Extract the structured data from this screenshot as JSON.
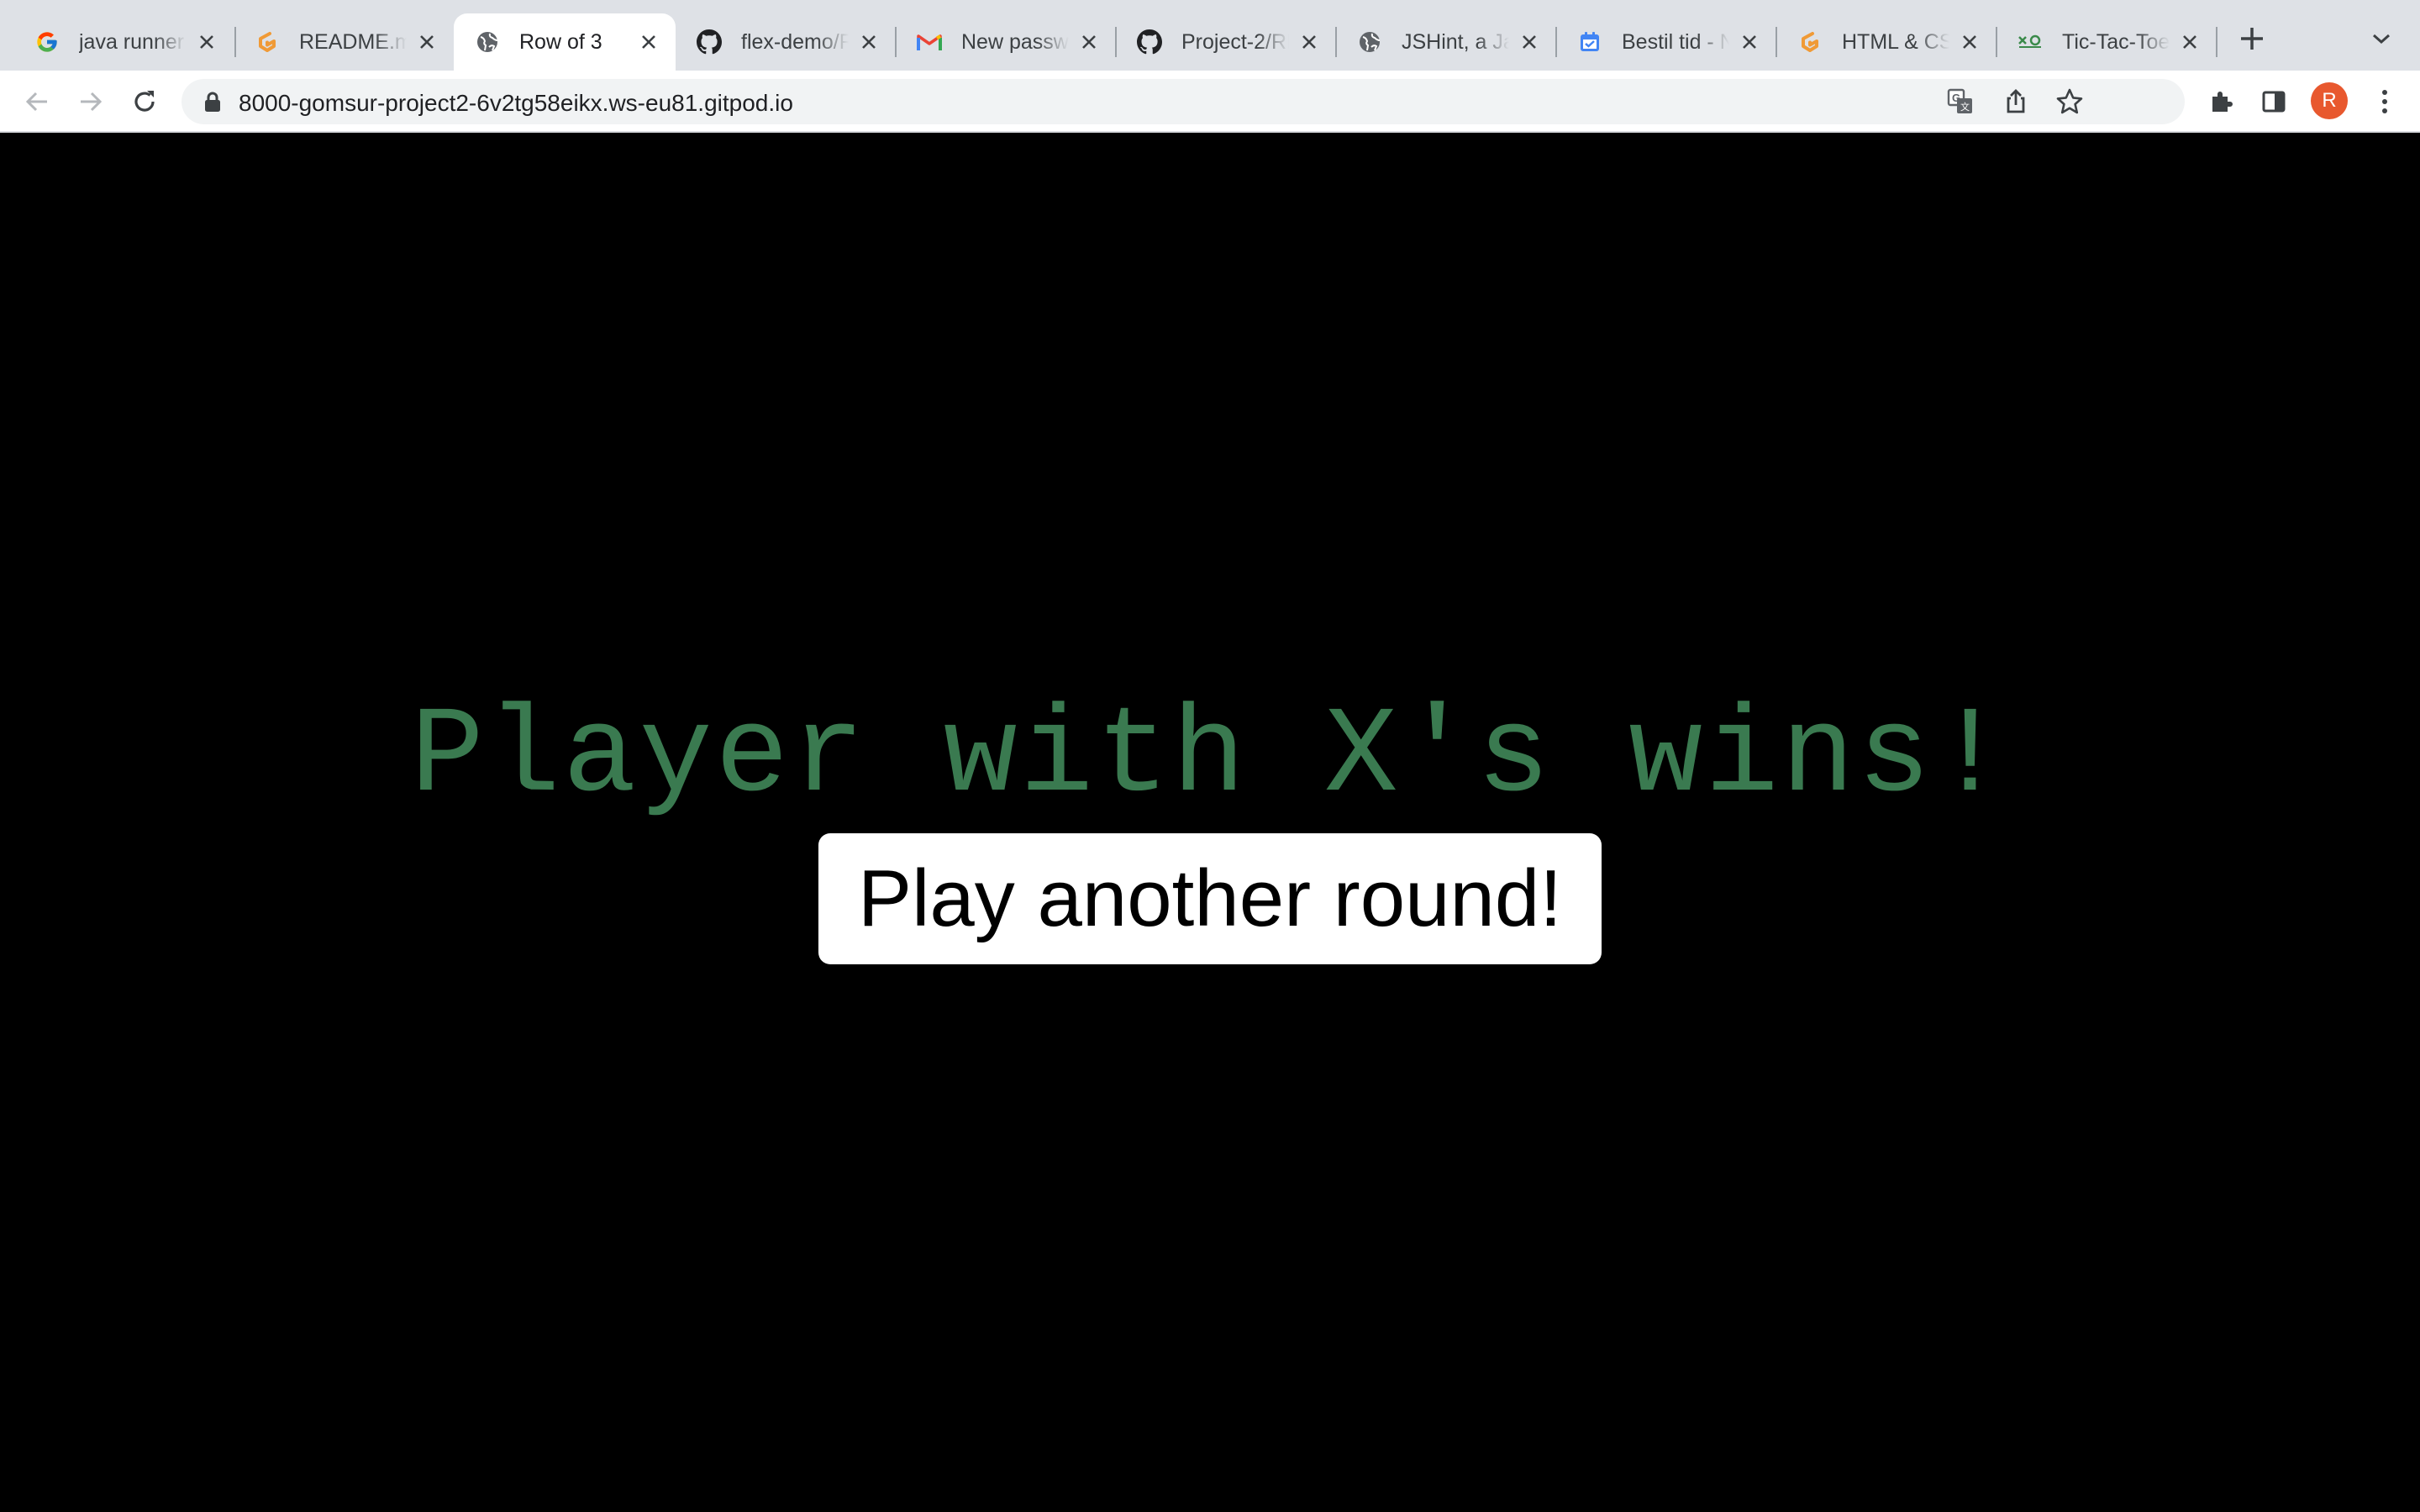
{
  "tabs": [
    {
      "title": "java runner",
      "icon": "google-icon",
      "active": false
    },
    {
      "title": "README.md",
      "icon": "gitpod-icon",
      "active": false
    },
    {
      "title": "Row of 3",
      "icon": "globe-icon",
      "active": true
    },
    {
      "title": "flex-demo/R",
      "icon": "github-icon",
      "active": false
    },
    {
      "title": "New passwo",
      "icon": "gmail-icon",
      "active": false
    },
    {
      "title": "Project-2/RE",
      "icon": "github-icon",
      "active": false
    },
    {
      "title": "JSHint, a Ja",
      "icon": "globe-icon",
      "active": false
    },
    {
      "title": "Bestil tid - N",
      "icon": "calendar-check-icon",
      "active": false
    },
    {
      "title": "HTML & CSS",
      "icon": "gitpod-icon",
      "active": false
    },
    {
      "title": "Tic-Tac-Toe",
      "icon": "tictactoe-icon",
      "active": false
    }
  ],
  "browser": {
    "url": "8000-gomsur-project2-6v2tg58eikx.ws-eu81.gitpod.io",
    "profile_initial": "R",
    "profile_color": "#e8582e"
  },
  "game": {
    "result_message": "Player with X's wins!",
    "play_again_label": "Play another round!",
    "message_color": "#3a7a50",
    "background_color": "#000000"
  }
}
